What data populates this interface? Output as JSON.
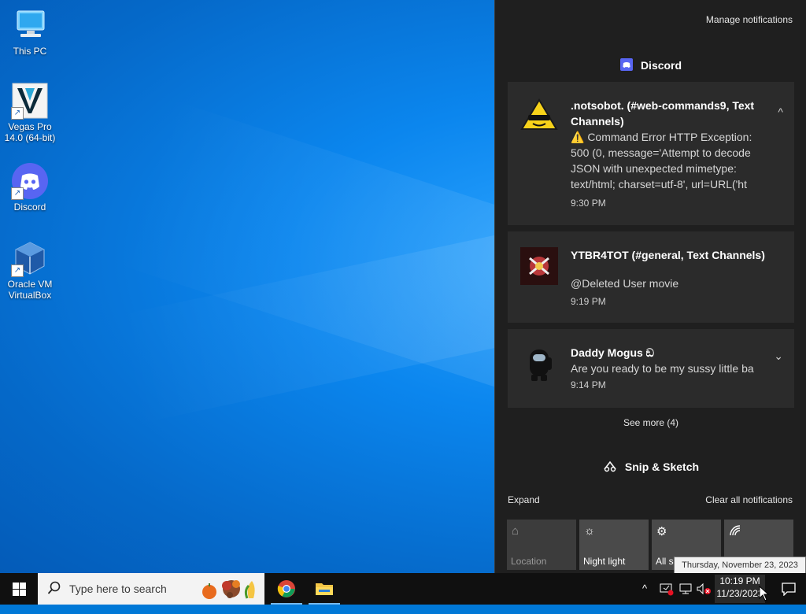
{
  "desktop": {
    "icons": [
      {
        "label": "This PC",
        "icon": "this-pc-icon"
      },
      {
        "label": "Vegas Pro\n14.0 (64-bit)",
        "icon": "vegas-pro-icon"
      },
      {
        "label": "Discord",
        "icon": "discord-icon"
      },
      {
        "label": "Oracle VM\nVirtualBox",
        "icon": "virtualbox-icon"
      }
    ]
  },
  "action_center": {
    "manage_label": "Manage notifications",
    "discord_group": "Discord",
    "notifications": [
      {
        "title": ".notsobot. (#web-commands9, Text Channels)",
        "body_lines": [
          "⚠️ Command Error HTTP Exception:",
          "500 (0, message='Attempt to decode",
          "JSON with unexpected mimetype:",
          "text/html; charset=utf-8', url=URL('ht"
        ],
        "time": "9:30 PM",
        "chevron": "^"
      },
      {
        "title": "YTBR4TOT (#general, Text Channels)",
        "body_lines": [
          "@Deleted User movie"
        ],
        "time": "9:19 PM"
      },
      {
        "title": "Daddy Mogus ඞ",
        "body_lines": [
          "Are you ready to be my sussy little ba"
        ],
        "time": "9:14 PM",
        "chevron": "⌄"
      }
    ],
    "see_more": "See more (4)",
    "snip_group": "Snip & Sketch",
    "expand_label": "Expand",
    "clear_all_label": "Clear all notifications",
    "quick_actions": [
      {
        "label": "Location",
        "icon": "location-icon",
        "enabled": false
      },
      {
        "label": "Night light",
        "icon": "night-light-icon",
        "enabled": true
      },
      {
        "label": "All settings",
        "icon": "settings-gear-icon",
        "enabled": true
      },
      {
        "label": "",
        "icon": "network-icon",
        "enabled": true
      }
    ]
  },
  "tooltip": "Thursday, November 23, 2023",
  "taskbar": {
    "search_placeholder": "Type here to search",
    "clock_time": "10:19 PM",
    "clock_date": "11/23/2023",
    "tray_overflow": "^"
  },
  "colors": {
    "action_center_bg": "#1f1f1f",
    "card_bg": "#2b2b2b",
    "taskbar_bg": "#101010",
    "accent": "#0078d7"
  }
}
